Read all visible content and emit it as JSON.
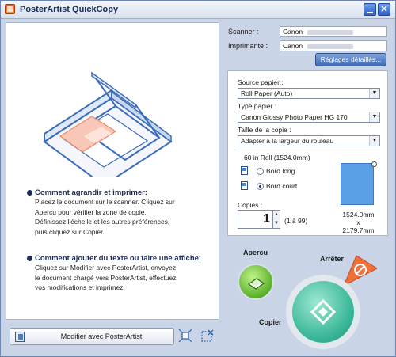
{
  "window": {
    "title": "PosterArtist QuickCopy",
    "close_glyph": "✕"
  },
  "devices": {
    "scanner_label": "Scanner :",
    "scanner_value": "Canon",
    "printer_label": "Imprimante :",
    "printer_value": "Canon",
    "details_button": "Réglages détaillés..."
  },
  "settings": {
    "paper_source_label": "Source papier :",
    "paper_source_value": "Roll Paper (Auto)",
    "paper_type_label": "Type papier :",
    "paper_type_value": "Canon Glossy Photo Paper HG 170",
    "copy_size_label": "Taille de la copie :",
    "copy_size_value": "Adapter à la largeur du rouleau",
    "roll_info": "60 in Roll (1524.0mm)",
    "edge_long_label": "Bord long",
    "edge_short_label": "Bord court",
    "selected_edge": "Bord court",
    "copies_label": "Copies :",
    "copies_value": "1",
    "copies_range": "(1 à 99)",
    "output_width": "1524.0mm",
    "output_x": "x",
    "output_height": "2179.7mm",
    "dropdown_arrow": "▼",
    "spin_up": "▲",
    "spin_down": "▼"
  },
  "instructions": {
    "section1_title": "Comment agrandir et imprimer:",
    "section1_lines": [
      "Placez le document sur le scanner. Cliquez sur",
      "Apercu pour vérifier la zone de copie.",
      "Définissez l'échelle et les autres préférences,",
      "puis cliquez sur Copier."
    ],
    "section2_title": "Comment ajouter du texte ou faire une affiche:",
    "section2_lines": [
      "Cliquez sur Modifier avec PosterArtist, envoyez",
      "le document chargé vers PosterArtist, effectuez",
      "vos modifications et imprimez."
    ]
  },
  "actions": {
    "modify_button": "Modifier avec PosterArtist",
    "preview_label": "Apercu",
    "stop_label": "Arrêter",
    "copy_label": "Copier"
  },
  "colors": {
    "accent": "#3f6ab5",
    "preview_button": "#5cb02a",
    "copy_button": "#38b696",
    "stop_button": "#f0703a",
    "paper_preview": "#5aa0e6"
  }
}
